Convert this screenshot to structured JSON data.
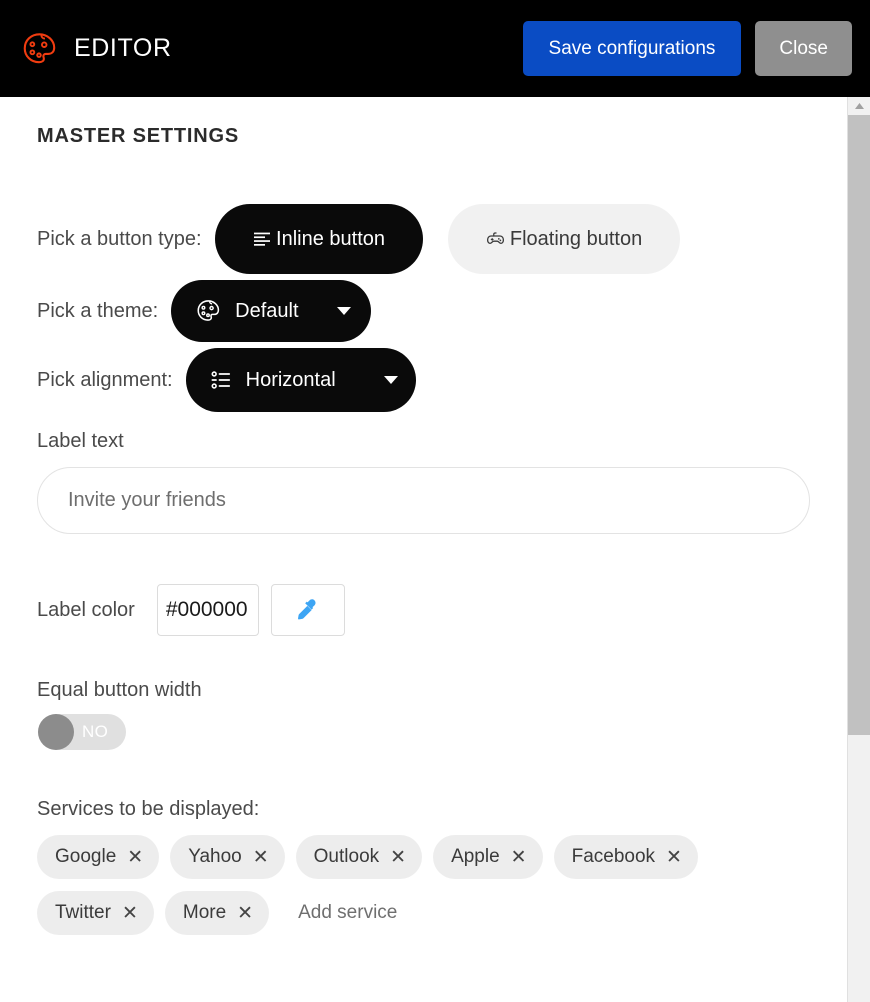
{
  "header": {
    "logo_icon": "palette-icon",
    "logo_color": "#F03C10",
    "title": "EDITOR",
    "save_label": "Save configurations",
    "save_color": "#0A4CC4",
    "close_label": "Close",
    "close_color": "#8F8F8F"
  },
  "main": {
    "section_title": "MASTER SETTINGS",
    "button_type": {
      "label": "Pick a button type:",
      "options": [
        {
          "label": "Inline button",
          "icon": "text-lines-icon",
          "selected": true
        },
        {
          "label": "Floating button",
          "icon": "gamepad-icon",
          "selected": false
        }
      ]
    },
    "theme": {
      "label": "Pick a theme:",
      "icon": "palette-icon",
      "value": "Default",
      "caret_icon": "chevron-down-icon"
    },
    "alignment": {
      "label": "Pick alignment:",
      "icon": "bullet-list-icon",
      "value": "Horizontal",
      "caret_icon": "chevron-down-icon"
    },
    "label_text": {
      "label": "Label text",
      "value": "",
      "placeholder": "Invite your friends"
    },
    "label_color": {
      "label": "Label color",
      "value": "#000000",
      "picker_icon": "eyedropper-icon",
      "picker_color": "#3DA5F4"
    },
    "equal_width": {
      "label": "Equal button width",
      "state_text": "NO",
      "on": false
    },
    "services": {
      "label": "Services to be displayed:",
      "chips": [
        {
          "label": "Google",
          "remove_icon": "close-icon"
        },
        {
          "label": "Yahoo",
          "remove_icon": "close-icon"
        },
        {
          "label": "Outlook",
          "remove_icon": "close-icon"
        },
        {
          "label": "Apple",
          "remove_icon": "close-icon"
        },
        {
          "label": "Facebook",
          "remove_icon": "close-icon"
        },
        {
          "label": "Twitter",
          "remove_icon": "close-icon"
        },
        {
          "label": "More",
          "remove_icon": "close-icon"
        }
      ],
      "add_label": "Add service"
    }
  },
  "scrollbar": {
    "up_icon": "triangle-up-icon"
  }
}
